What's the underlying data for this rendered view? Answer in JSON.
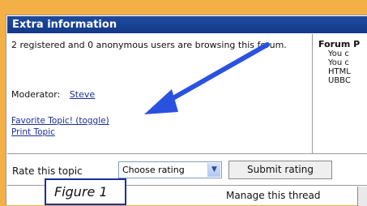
{
  "header": {
    "title": "Extra information"
  },
  "left_panel": {
    "users_text": "2 registered and 0 anonymous users are browsing this forum.",
    "moderator_label": "Moderator:",
    "moderator_name": "Steve",
    "favorite_link": "Favorite Topic! (toggle)",
    "print_link": "Print Topic"
  },
  "right_panel": {
    "title": "Forum P",
    "lines": [
      "You c",
      "You c",
      "HTML",
      "UBBC"
    ]
  },
  "rating": {
    "label": "Rate this topic",
    "select_value": "Choose rating",
    "submit_label": "Submit rating"
  },
  "manage": {
    "label": "Manage this thread"
  },
  "figure": {
    "label": "Figure 1"
  },
  "colors": {
    "background": "#f2b046",
    "header": "#1f4a9c",
    "link": "#1c2f9a",
    "arrow": "#2a52e0"
  }
}
